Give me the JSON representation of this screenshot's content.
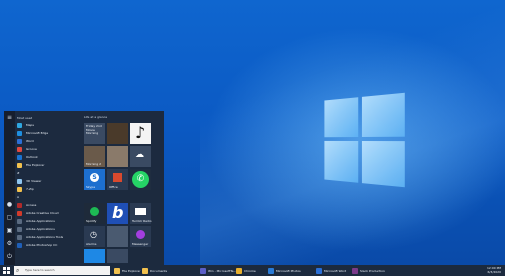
{
  "start_menu": {
    "section_most_used": "Most used",
    "section_life": "Life at a glance",
    "apps": [
      {
        "label": "Maps",
        "color": "#2fa7e0"
      },
      {
        "label": "Microsoft Edge",
        "color": "#1e8fe0"
      },
      {
        "label": "Word",
        "color": "#2b6fd6"
      },
      {
        "label": "Groove",
        "color": "#e0483e"
      },
      {
        "label": "Outlook",
        "color": "#1a73d1"
      },
      {
        "label": "File Explorer",
        "color": "#f2c14e"
      },
      {
        "label": "#",
        "color": ""
      },
      {
        "label": "3D Viewer",
        "color": "#8ec5f0"
      },
      {
        "label": "7-Zip",
        "color": "#f2c14e"
      },
      {
        "label": "A",
        "color": ""
      },
      {
        "label": "Access",
        "color": "#b12a2a"
      },
      {
        "label": "Adobe Creative Cloud",
        "color": "#d23a2a"
      },
      {
        "label": "Adobe Applications",
        "color": "#5a6a80"
      },
      {
        "label": "Adobe Applications",
        "color": "#5a6a80"
      },
      {
        "label": "Adobe Applications Tools",
        "color": "#5a6a80"
      },
      {
        "label": "Adobe Photoshop CC",
        "color": "#1f5fb8"
      }
    ],
    "tiles": {
      "calendar_text": "Friday 2nd Movie Morning",
      "mail_label": "Mail",
      "music_label": "Groove Music",
      "tile_a_label": "Morning 2",
      "skype_label": "Skype",
      "office_label": "Office",
      "whatsapp_label": "WhatsApp",
      "spotify_label": "Spotify",
      "bing_label": "b",
      "netflix_label": "Tumblr Radio",
      "alarm_label": "Alarms",
      "messenger_label": "Messenger"
    }
  },
  "taskbar": {
    "search_placeholder": "Type here to search",
    "items": [
      {
        "label": "File Explorer",
        "color": "#f2c14e"
      },
      {
        "label": "Documents",
        "color": "#f2c14e"
      },
      {
        "label": "Win - MicrosoftTe...",
        "color": "#5b5fc7"
      },
      {
        "label": "Chrome",
        "color": "#e8b02e"
      },
      {
        "label": "Microsoft Photos",
        "color": "#2a7bd6"
      },
      {
        "label": "Microsoft Word",
        "color": "#2b6fd6"
      },
      {
        "label": "Slack Production",
        "color": "#7a3a8a"
      }
    ],
    "tray_time": "12:00 PM",
    "tray_date": "6/3/2020"
  }
}
